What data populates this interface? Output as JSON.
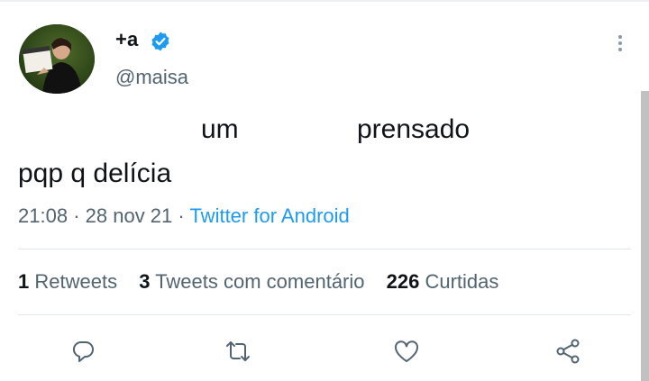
{
  "author": {
    "display_name": "+a",
    "handle": "@maisa",
    "verified": true
  },
  "tweet": {
    "line1_word1": "um",
    "line1_word2": "prensado",
    "line2": "pqp q delícia"
  },
  "meta": {
    "time": "21:08",
    "date": "28 nov 21",
    "source": "Twitter for Android",
    "separator": "·"
  },
  "stats": {
    "retweets_count": "1",
    "retweets_label": "Retweets",
    "quotes_count": "3",
    "quotes_label": "Tweets com comentário",
    "likes_count": "226",
    "likes_label": "Curtidas"
  },
  "actions": [
    "reply-icon",
    "retweet-icon",
    "like-icon",
    "share-icon"
  ],
  "colors": {
    "link": "#1d9bf0",
    "muted": "#536471",
    "text": "#0f1419"
  }
}
